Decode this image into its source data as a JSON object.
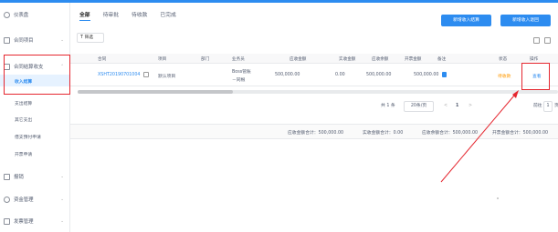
{
  "sidebar": {
    "items": [
      {
        "label": "仪表盘"
      },
      {
        "label": "合同项目"
      },
      {
        "label": "合同结算收支"
      },
      {
        "label": "报销"
      },
      {
        "label": "资金管理"
      },
      {
        "label": "发票管理"
      }
    ],
    "subitems": [
      {
        "label": "收入结算"
      },
      {
        "label": "支出结算"
      },
      {
        "label": "其它支出"
      },
      {
        "label": "借支预付申请"
      },
      {
        "label": "开票申请"
      }
    ]
  },
  "tabs": [
    {
      "label": "全部"
    },
    {
      "label": "待审批"
    },
    {
      "label": "待收款"
    },
    {
      "label": "已完成"
    }
  ],
  "buttons": {
    "add_income": "新增收入结算",
    "add_income_2": "新增收入退回"
  },
  "filter": {
    "label": "T 筛选"
  },
  "table": {
    "headers": [
      "合同",
      "项目",
      "部门",
      "业务员",
      "应收金额",
      "实收金额",
      "应收余额",
      "开票金额",
      "备注",
      "状态",
      "操作"
    ],
    "row": {
      "contract": "XSHT20190701004",
      "project": "默认项目",
      "department": "",
      "salesperson_1": "Boss管账",
      "salesperson_2": "－同根",
      "receivable": "500,000.00",
      "received": "0.00",
      "balance": "500,000.00",
      "invoice": "500,000.00",
      "status": "待收款",
      "action": "查看"
    }
  },
  "pager": {
    "total": "共 1 条",
    "size": "20条/页",
    "prev": "<",
    "page": "1",
    "next": ">",
    "goto": "前往",
    "goto_value": "1",
    "unit": "页"
  },
  "summary": {
    "receivable": "应收金额合计：500,000.00",
    "received": "实收金额合计：0.00",
    "balance": "应收余额合计：500,000.00",
    "invoice": "开票金额合计：500,000.00"
  },
  "colors": {
    "accent": "#2d8cf0",
    "highlight": "#e5262f",
    "pending": "#ff9900"
  }
}
